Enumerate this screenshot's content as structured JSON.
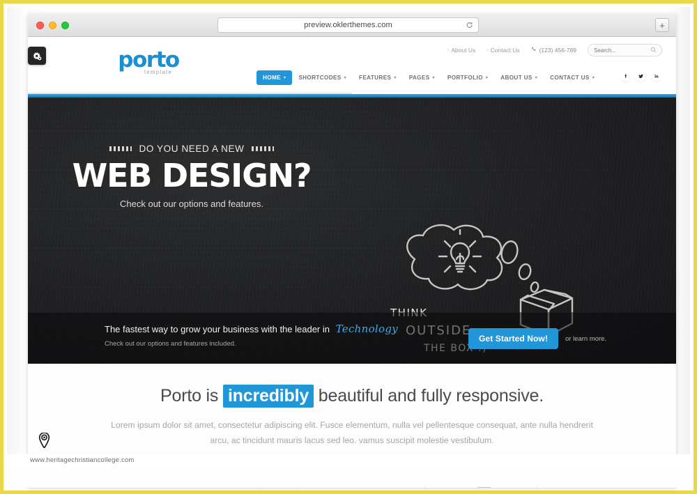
{
  "browser": {
    "url": "preview.oklerthemes.com",
    "reload_icon": "reload-icon",
    "newtab_label": "+",
    "traffic_lights": [
      "close",
      "minimize",
      "maximize"
    ]
  },
  "overlay": {
    "cog_icon": "cogs-icon",
    "pin_icon": "map-pin-icon",
    "watermark": "www.heritagechristiancollege.com"
  },
  "site": {
    "logo": {
      "word": "porto",
      "sub": "template"
    },
    "topbar": {
      "about_label": "About Us",
      "contact_label": "Contact Us",
      "phone": "(123) 456-789",
      "phone_icon": "phone-icon",
      "search_placeholder": "Search...",
      "search_value": "",
      "search_icon": "search-icon"
    },
    "nav": [
      {
        "label": "HOME",
        "active": true,
        "caret": "▾"
      },
      {
        "label": "SHORTCODES",
        "active": false,
        "caret": "▾"
      },
      {
        "label": "FEATURES",
        "active": false,
        "caret": "▾"
      },
      {
        "label": "PAGES",
        "active": false,
        "caret": "▾"
      },
      {
        "label": "PORTFOLIO",
        "active": false,
        "caret": "▾"
      },
      {
        "label": "ABOUT US",
        "active": false,
        "caret": "▾"
      },
      {
        "label": "CONTACT US",
        "active": false,
        "caret": "▾"
      }
    ],
    "social": [
      {
        "name": "facebook-icon",
        "glyph": "f"
      },
      {
        "name": "twitter-icon",
        "glyph": "t"
      },
      {
        "name": "linkedin-icon",
        "glyph": "in"
      }
    ],
    "accent_color": "#2196d9"
  },
  "hero": {
    "kicker": "DO YOU NEED A NEW",
    "headline": "WEB DESIGN?",
    "subheadline": "Check out our options and features.",
    "chalk": {
      "line1": "THINK",
      "line2": "OUTSIDE",
      "line3": "THE BOX :)",
      "illustration": "thought-bubble-lightbulb-and-box"
    },
    "bottom": {
      "line1_prefix": "The fastest way to grow your business with the leader in",
      "line1_accent": "Technology",
      "line2": "Check out our options and features included.",
      "cta_label": "Get Started Now!",
      "learn_more": "or learn more."
    }
  },
  "section": {
    "claim_prefix": "Porto is",
    "claim_highlight": "incredibly",
    "claim_suffix": "beautiful and fully responsive.",
    "lead": "Lorem ipsum dolor sit amet, consectetur adipiscing elit. Fusce elementum, nulla vel pellentesque consequat, ante nulla hendrerit arcu, ac tincidunt mauris lacus sed leo. vamus suscipit molestie vestibulum."
  }
}
